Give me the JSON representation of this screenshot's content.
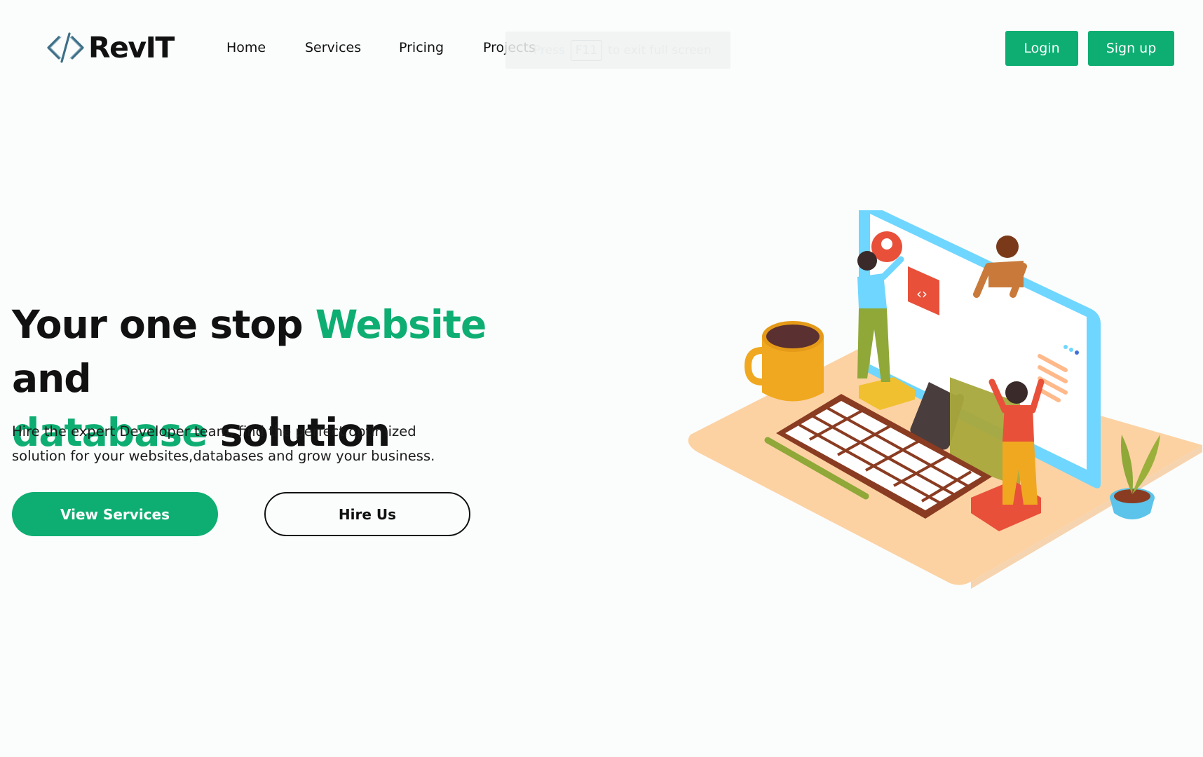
{
  "brand": {
    "name": "RevIT",
    "accent_color": "#0eae72"
  },
  "nav": {
    "items": [
      {
        "label": "Home"
      },
      {
        "label": "Services"
      },
      {
        "label": "Pricing"
      },
      {
        "label": "Projects"
      }
    ]
  },
  "fullscreen_notice": {
    "press": "Press",
    "key": "F11",
    "rest": "to exit full screen"
  },
  "auth": {
    "login_label": "Login",
    "signup_label": "Sign up"
  },
  "hero": {
    "title_part1": "Your one stop ",
    "title_accent1": "Website",
    "title_part2": " and",
    "title_accent2": "database",
    "title_part3": " solution",
    "subtitle_line1": "Hire the expert Developer team, find the perfect optimized",
    "subtitle_line2": "solution for your websites,databases and grow your business.",
    "primary_cta": "View Services",
    "secondary_cta": "Hire Us"
  }
}
